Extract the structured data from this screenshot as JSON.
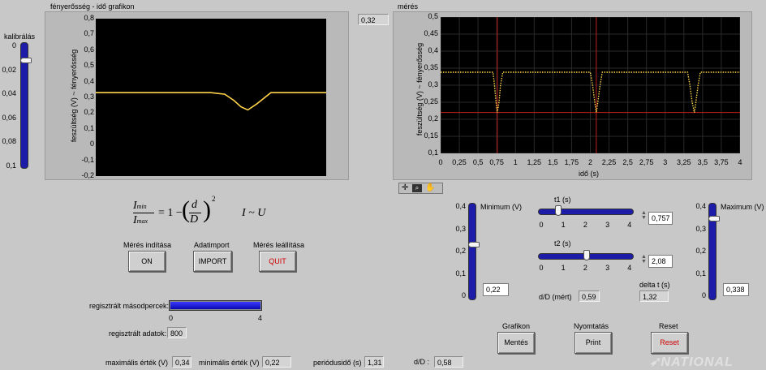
{
  "graph1": {
    "title": "fényerősség - idő grafikon",
    "ylabel": "feszültség (V) ~ fényerősség",
    "yticks": [
      "0,8",
      "0,7",
      "0,6",
      "0,5",
      "0,4",
      "0,3",
      "0,2",
      "0,1",
      "0",
      "-0,1",
      "-0,2"
    ]
  },
  "graph2": {
    "title": "mérés",
    "ylabel": "feszültség (V) ~ fényerősség",
    "xlabel": "idő (s)",
    "yticks": [
      "0,5",
      "0,45",
      "0,4",
      "0,35",
      "0,3",
      "0,25",
      "0,2",
      "0,15",
      "0,1"
    ],
    "xticks": [
      "0",
      "0,25",
      "0,5",
      "0,75",
      "1",
      "1,25",
      "1,5",
      "1,75",
      "2",
      "2,25",
      "2,5",
      "2,75",
      "3",
      "3,25",
      "3,5",
      "3,75",
      "4"
    ]
  },
  "calibration": {
    "label": "kalibrálás",
    "ticks": [
      "0",
      "0,02",
      "0,04",
      "0,06",
      "0,08",
      "0,1"
    ],
    "value": 0.01
  },
  "top_readout": "0,32",
  "formula": {
    "left": "I",
    "sub_min": "min",
    "sub_max": "max",
    "rhs": "= 1 −",
    "d": "d",
    "D": "D",
    "exp": "2",
    "prop": "I ~ U"
  },
  "buttons": {
    "start_title": "Mérés indítása",
    "start_label": "ON",
    "import_title": "Adatimport",
    "import_label": "IMPORT",
    "stop_title": "Mérés leállítása",
    "stop_label": "QUIT",
    "graph_title": "Grafikon",
    "graph_label": "Mentés",
    "print_title": "Nyomtatás",
    "print_label": "Print",
    "reset_title": "Reset",
    "reset_label": "Reset"
  },
  "progress": {
    "label": "regisztrált másodpercek:",
    "min": "0",
    "max": "4",
    "fraction": 1.0
  },
  "recorded": {
    "label": "regisztrált adatok:",
    "value": "800"
  },
  "bottom": {
    "max_label": "maximális érték (V)",
    "max_value": "0,34",
    "min_label": "minimális érték (V)",
    "min_value": "0,22",
    "period_label": "periódusidő (s)",
    "period_value": "1,31",
    "dD_label": "d/D :",
    "dD_value": "0,58"
  },
  "minimum": {
    "title": "Minimum (V)",
    "ticks": [
      "0,4",
      "0,3",
      "0,2",
      "0,1",
      "0"
    ],
    "value": "0,22"
  },
  "maximum": {
    "title": "Maximum (V)",
    "ticks": [
      "0,4",
      "0,3",
      "0,2",
      "0,1",
      "0"
    ],
    "value": "0,338"
  },
  "t1": {
    "title": "t1 (s)",
    "ticks": [
      "0",
      "1",
      "2",
      "3",
      "4"
    ],
    "value": "0,757"
  },
  "t2": {
    "title": "t2 (s)",
    "ticks": [
      "0",
      "1",
      "2",
      "3",
      "4"
    ],
    "value": "2,08"
  },
  "dD_measured": {
    "label": "d/D (mért)",
    "value": "0,59"
  },
  "delta_t": {
    "label": "delta t (s)",
    "value": "1,32"
  },
  "watermark": "NATIONAL",
  "chart_data": [
    {
      "type": "line",
      "title": "fényerősség - idő grafikon",
      "ylabel": "feszültség (V) ~ fényerősség",
      "ylim": [
        -0.2,
        0.8
      ],
      "x": [
        0,
        0.5,
        0.56,
        0.6,
        0.63,
        0.66,
        0.7,
        0.76,
        1.0
      ],
      "series": [
        {
          "values": [
            0.33,
            0.33,
            0.32,
            0.28,
            0.24,
            0.22,
            0.26,
            0.33,
            0.33
          ]
        }
      ]
    },
    {
      "type": "line",
      "title": "mérés",
      "xlabel": "idő (s)",
      "ylabel": "feszültség (V) ~ fényerősség",
      "xlim": [
        0,
        4
      ],
      "ylim": [
        0.1,
        0.5
      ],
      "cursors_x": [
        0.757,
        2.08
      ],
      "cursor_y": 0.22,
      "x": [
        0,
        0.7,
        0.72,
        0.74,
        0.757,
        0.78,
        0.8,
        0.83,
        2.0,
        2.03,
        2.06,
        2.08,
        2.1,
        2.13,
        2.16,
        3.3,
        3.33,
        3.36,
        3.39,
        3.41,
        3.44,
        3.47,
        4.0
      ],
      "series": [
        {
          "values": [
            0.338,
            0.338,
            0.3,
            0.25,
            0.22,
            0.25,
            0.3,
            0.338,
            0.338,
            0.3,
            0.25,
            0.22,
            0.25,
            0.3,
            0.338,
            0.338,
            0.3,
            0.25,
            0.22,
            0.25,
            0.3,
            0.338,
            0.338
          ]
        }
      ]
    }
  ]
}
